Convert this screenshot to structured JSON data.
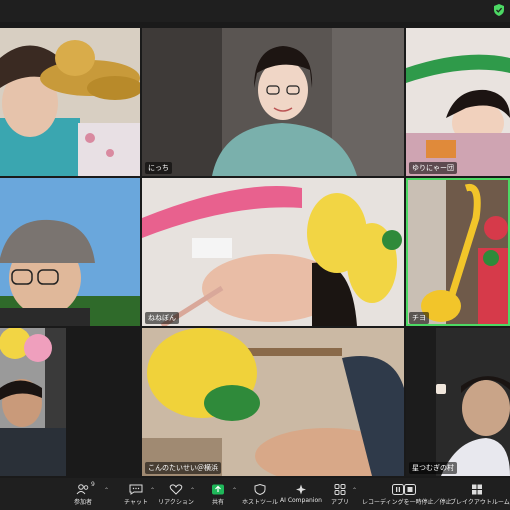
{
  "app": {
    "accent": "#4cd964",
    "background": "#1a1a1a"
  },
  "participants": [
    {
      "name": ""
    },
    {
      "name": "にっち"
    },
    {
      "name": "ゆりにゃー団"
    },
    {
      "name": ""
    },
    {
      "name": "ねねぼん"
    },
    {
      "name": "チヨ"
    },
    {
      "name": ""
    },
    {
      "name": "こんのたいせい＠横浜"
    },
    {
      "name": "星つむぎの村"
    }
  ],
  "toolbar": {
    "participants": {
      "label": "参加者",
      "count": "9",
      "icon": "people-icon"
    },
    "chat": {
      "label": "チャット",
      "icon": "chat-icon"
    },
    "reactions": {
      "label": "リアクション",
      "icon": "heart-icon"
    },
    "share": {
      "label": "共有",
      "icon": "share-arrow-icon"
    },
    "host_tools": {
      "label": "ホストツール",
      "icon": "shield-icon"
    },
    "ai_companion": {
      "label": "AI Companion",
      "icon": "sparkle-icon"
    },
    "apps": {
      "label": "アプリ",
      "icon": "apps-icon"
    },
    "recording": {
      "label": "レコーディングを一時停止／停止",
      "icon": "pause-stop-icon"
    },
    "breakout": {
      "label": "ブレイクアウトルーム",
      "icon": "grid-icon"
    }
  }
}
